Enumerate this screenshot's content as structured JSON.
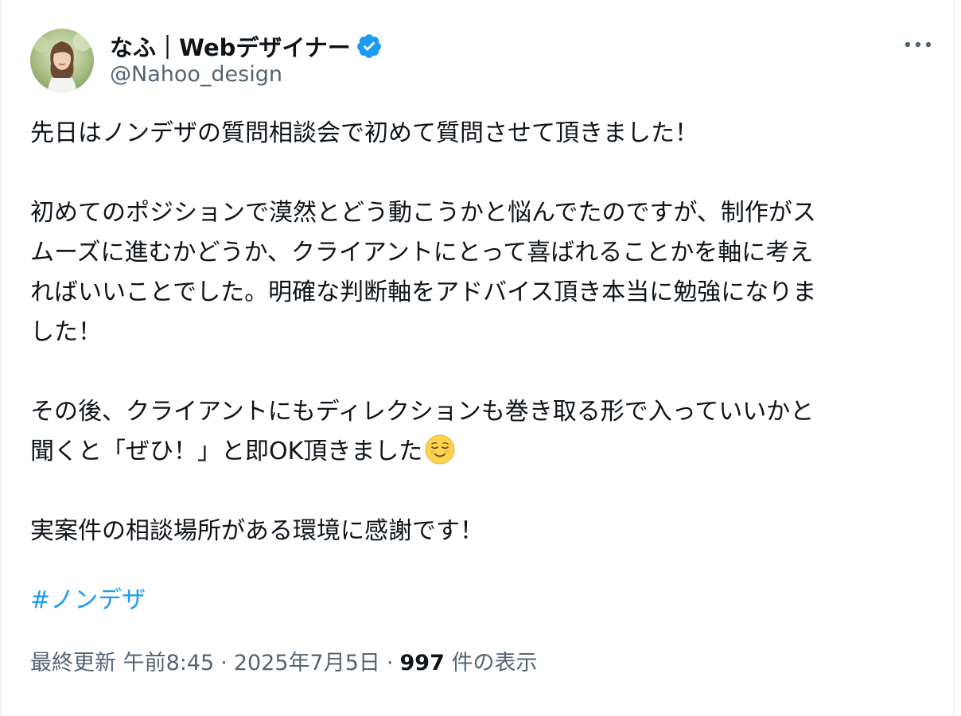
{
  "author": {
    "display_name": "なふ｜Webデザイナー",
    "handle": "@Nahoo_design",
    "verified": true
  },
  "tweet": {
    "paragraphs": [
      [
        "先日はノンデザの質問相談会で初めて質問させて頂きました！"
      ],
      [
        "初めてのポジションで漠然とどう動こうかと悩んでたのですが、制作がス",
        "ムーズに進むかどうか、クライアントにとって喜ばれることかを軸に考え",
        "ればいいことでした。明確な判断軸をアドバイス頂き本当に勉強になりま",
        "した！"
      ],
      [
        "その後、クライアントにもディレクションも巻き取る形で入っていいかと",
        "聞くと「ぜひ！」と即OK頂きました"
      ],
      [
        "実案件の相談場所がある環境に感謝です！"
      ]
    ],
    "emoji": "relieved-face",
    "hashtag": "#ノンデザ"
  },
  "meta": {
    "prefix": "最終更新",
    "time": "午前8:45",
    "separator": "·",
    "date": "2025年7月5日",
    "views_count": "997",
    "views_label": "件の表示"
  },
  "colors": {
    "text": "#0f1419",
    "secondary": "#536471",
    "link": "#1d9bf0",
    "verified": "#1d9bf0"
  }
}
